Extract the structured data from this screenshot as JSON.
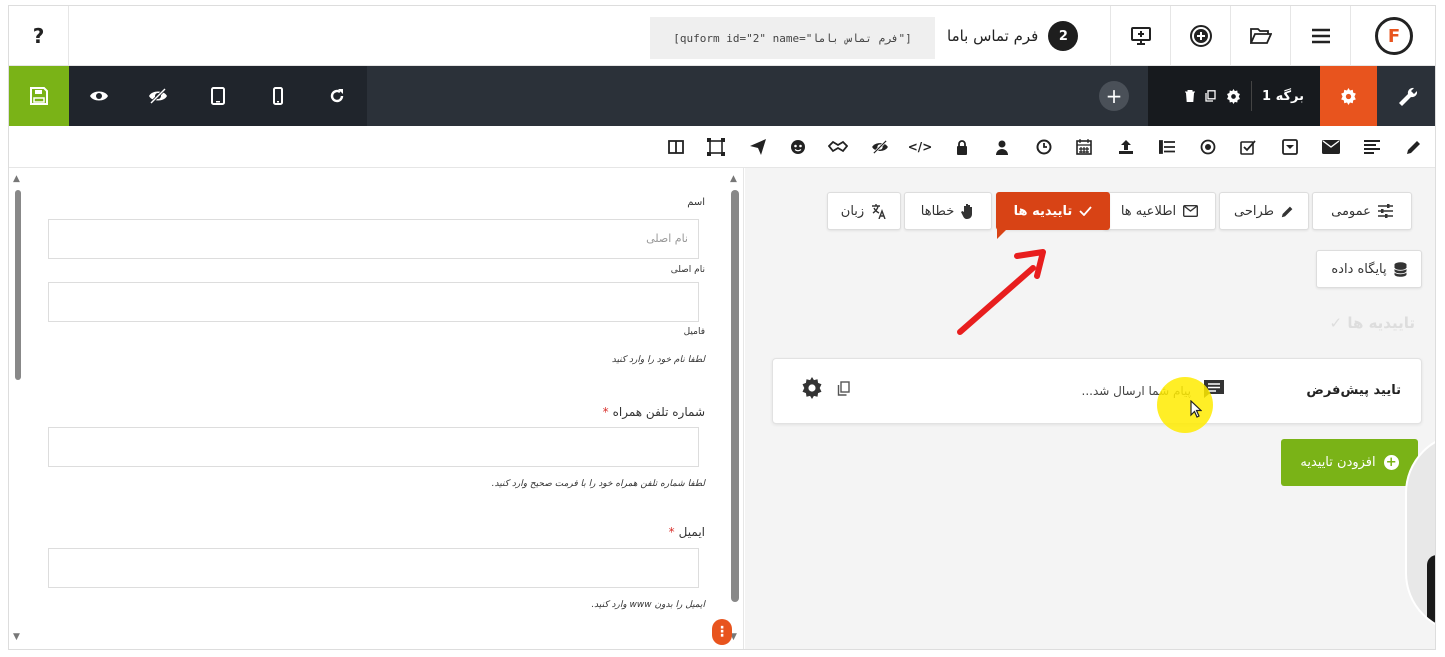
{
  "app": {
    "help_label": "?",
    "shortcode": "[quform id=\"2\" name=\"فرم تماس باما\"]",
    "form_number": "2",
    "form_title": "فرم تماس باما",
    "logo_letter": "F"
  },
  "toolbar": {
    "page_label": "برگه 1",
    "add_page_label": "+"
  },
  "preview": {
    "fields": [
      {
        "label": "اسم",
        "placeholder": "نام اصلی",
        "sublabel": "نام اصلی"
      },
      {
        "label": "فامیل",
        "hint": "لطفا نام خود را وارد کنید"
      },
      {
        "label": "شماره تلفن همراه",
        "required": "*",
        "hint": "لطفا شماره تلفن همراه خود را با فرمت صحیح وارد کنید."
      },
      {
        "label": "ایمیل",
        "required": "*",
        "hint": "ایمیل را بدون www وارد کنید."
      }
    ],
    "more_label": "⋮"
  },
  "settings": {
    "tabs": [
      {
        "label": "عمومی",
        "icon": "sliders-icon"
      },
      {
        "label": "طراحی",
        "icon": "brush-icon"
      },
      {
        "label": "اطلاعیه ها",
        "icon": "envelope-icon"
      },
      {
        "label": "تاییدیه ها",
        "icon": "check-icon",
        "active": true
      },
      {
        "label": "خطاها",
        "icon": "hand-icon"
      },
      {
        "label": "زبان",
        "icon": "translate-icon"
      },
      {
        "label": "پایگاه داده",
        "icon": "database-icon"
      }
    ],
    "section_title": "تاییدیه ها",
    "confirmation": {
      "title": "تایید پیش‌فرض",
      "message": "پیام شما ارسال شد..."
    },
    "add_button_label": "افزودن تاییدیه"
  },
  "colors": {
    "accent": "#e8541e",
    "active_tab": "#d84315",
    "save_green": "#7ab317",
    "dark_bar": "#2b3139"
  }
}
